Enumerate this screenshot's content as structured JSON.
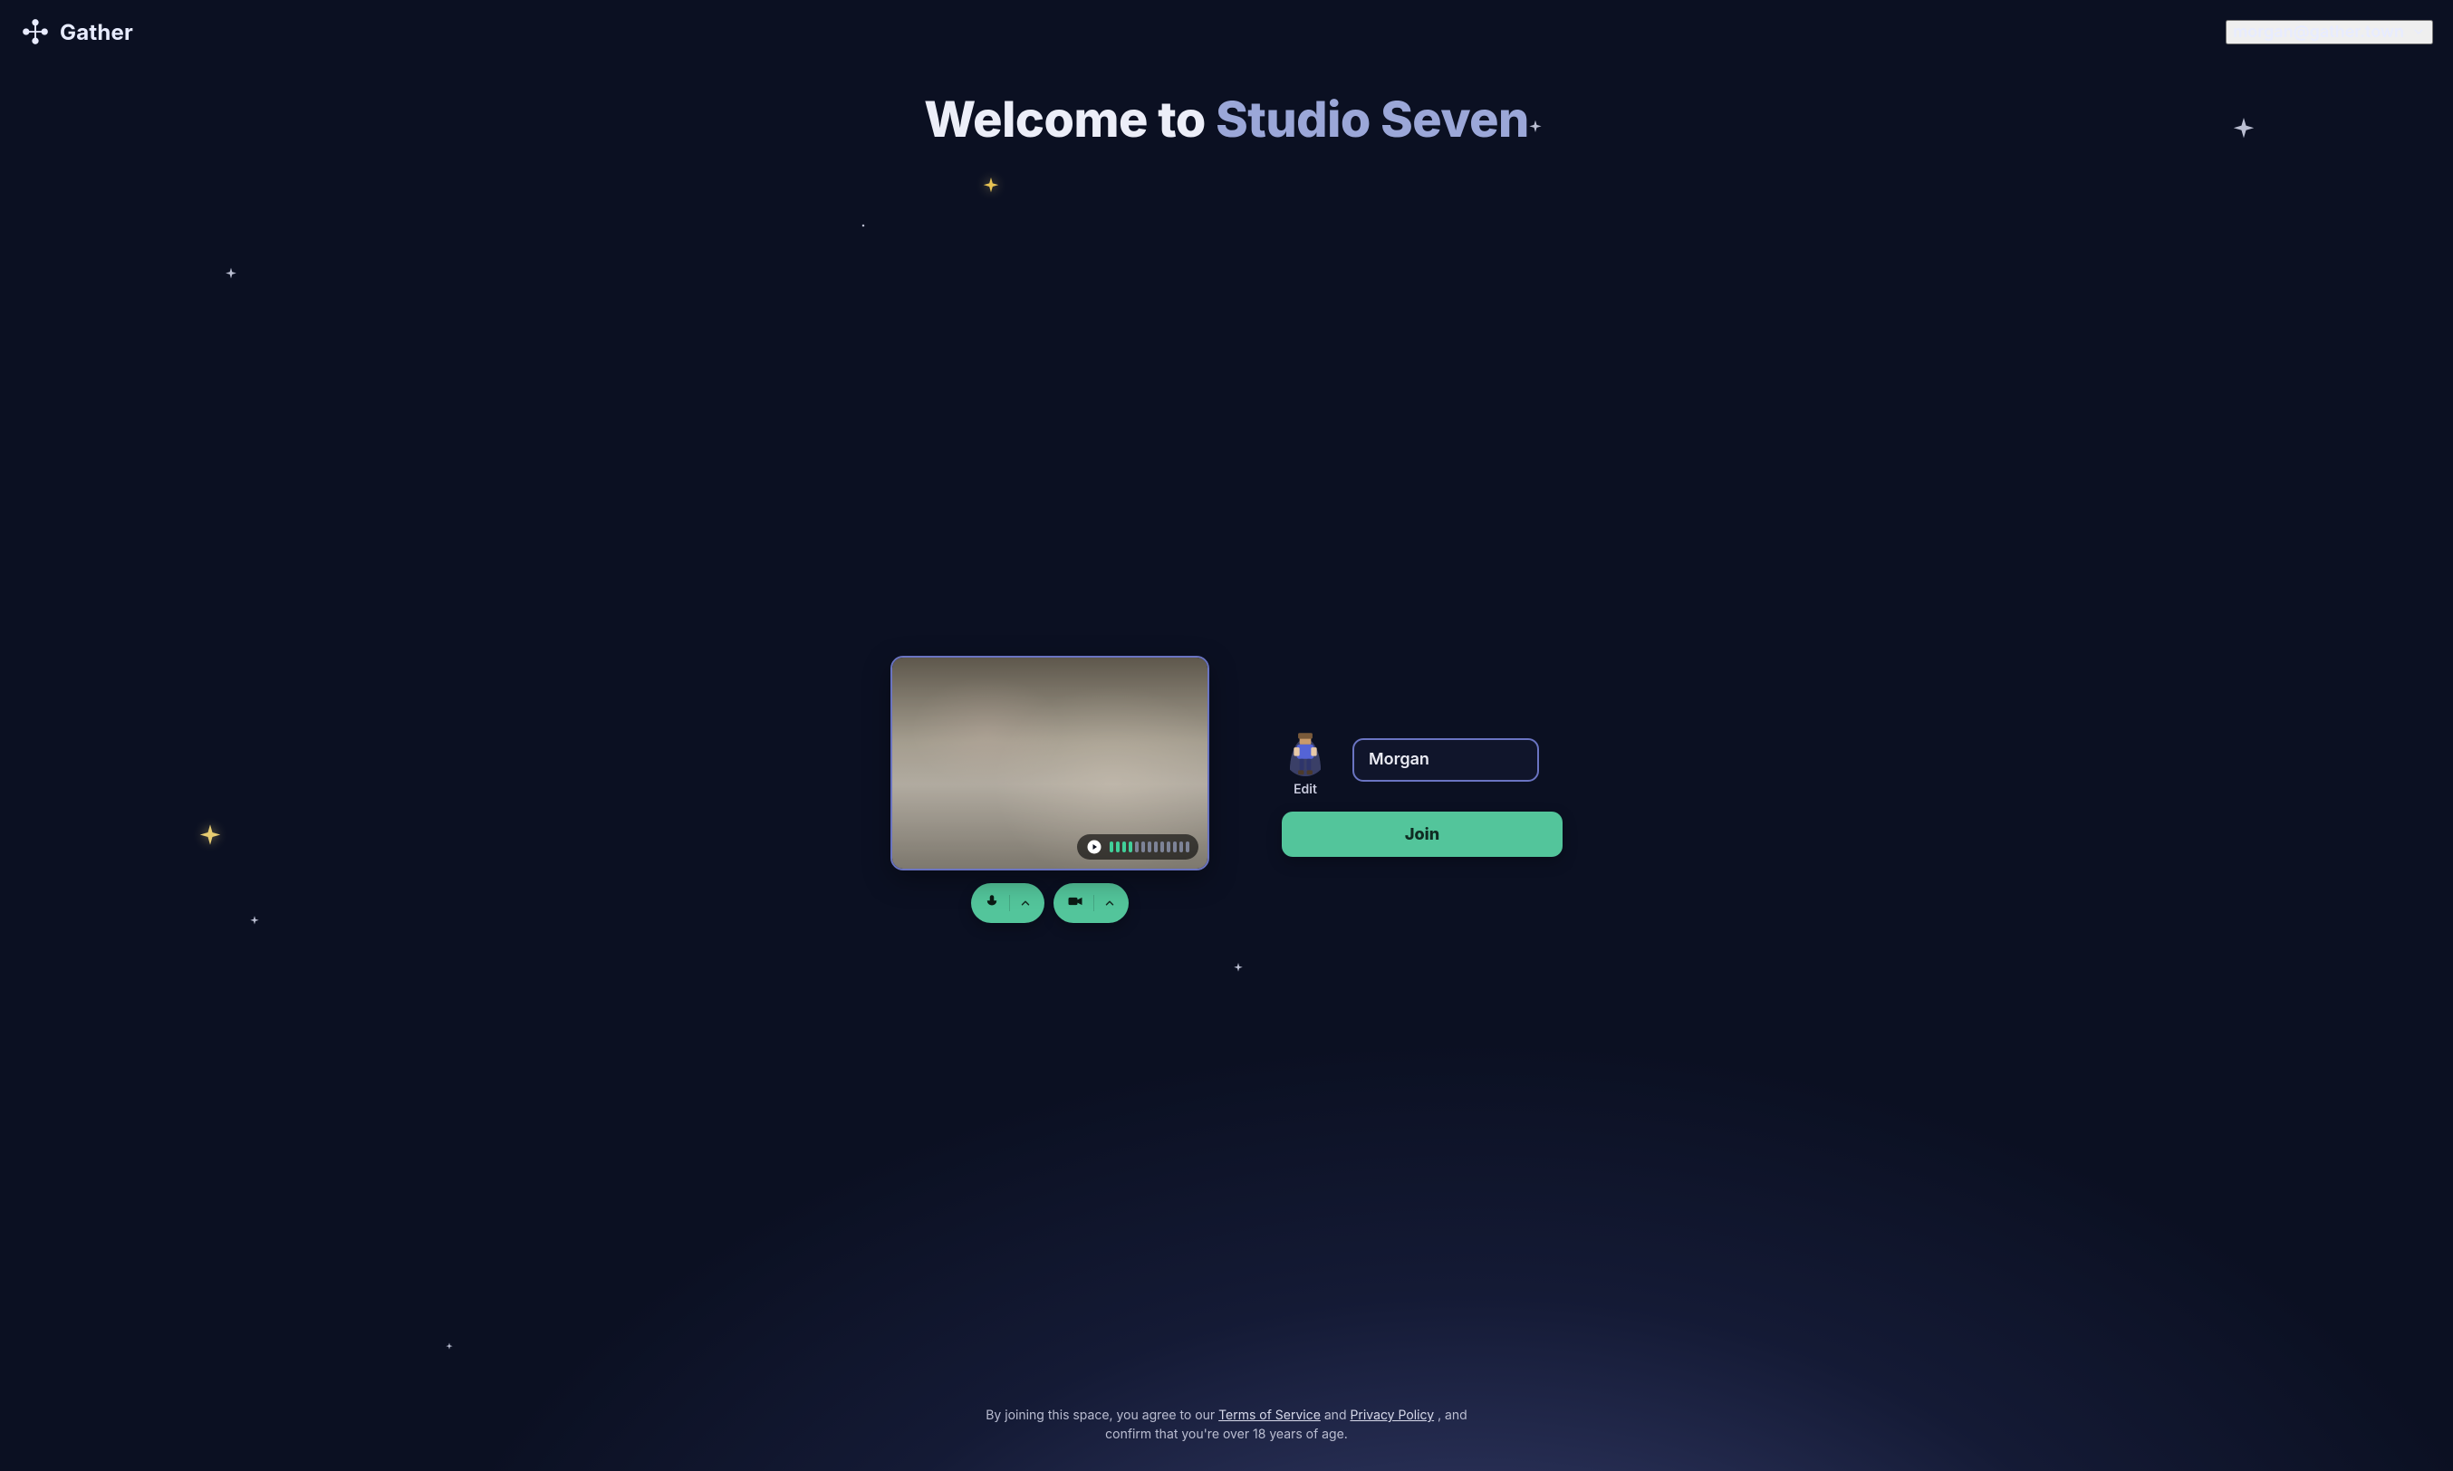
{
  "brand": {
    "name": "Gather"
  },
  "account": {
    "email": "morgan@gather.town"
  },
  "title": {
    "prefix": "Welcome to ",
    "space_name": "Studio Seven"
  },
  "video": {
    "vu": {
      "on_count": 4,
      "total_count": 13
    }
  },
  "controls": {
    "avatar_edit_label": "Edit",
    "name_value": "Morgan",
    "join_label": "Join"
  },
  "legal": {
    "pre": "By joining this space, you agree to our ",
    "tos": "Terms of Service",
    "mid": " and ",
    "privacy": "Privacy Policy",
    "post": ", and confirm that you're over 18 years of age."
  },
  "icons": {
    "play": "play-icon",
    "mic": "mic-icon",
    "camera": "camera-icon",
    "chevron_up": "chevron-up-icon",
    "chevron_down": "chevron-down-icon"
  },
  "colors": {
    "accent": "#9ba7d8",
    "green": "#53c59b",
    "card_border": "#6a74c2"
  }
}
